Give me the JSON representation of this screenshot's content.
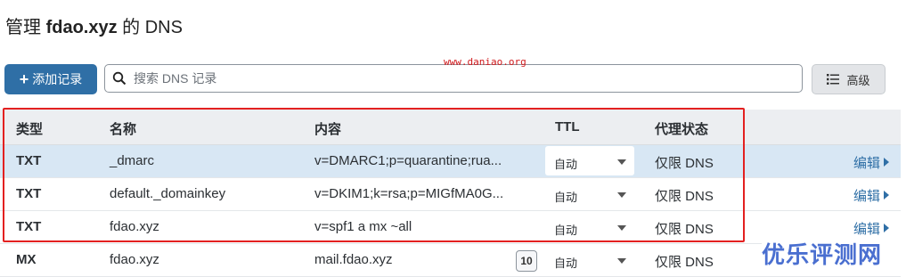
{
  "page": {
    "title_prefix": "管理 ",
    "domain": "fdao.xyz",
    "title_suffix": " 的 DNS"
  },
  "toolbar": {
    "add_label": "添加记录",
    "search_placeholder": "搜索 DNS 记录",
    "advanced_label": "高级"
  },
  "watermark": "www.daniao.org",
  "table": {
    "headers": {
      "type": "类型",
      "name": "名称",
      "content": "内容",
      "ttl": "TTL",
      "proxy": "代理状态"
    },
    "rows": [
      {
        "type": "TXT",
        "name": "_dmarc",
        "content": "v=DMARC1;p=quarantine;rua...",
        "ttl": "自动",
        "proxy": "仅限 DNS",
        "edit": "编辑",
        "priority": ""
      },
      {
        "type": "TXT",
        "name": "default._domainkey",
        "content": "v=DKIM1;k=rsa;p=MIGfMA0G...",
        "ttl": "自动",
        "proxy": "仅限 DNS",
        "edit": "编辑",
        "priority": ""
      },
      {
        "type": "TXT",
        "name": "fdao.xyz",
        "content": "v=spf1 a mx ~all",
        "ttl": "自动",
        "proxy": "仅限 DNS",
        "edit": "编辑",
        "priority": ""
      },
      {
        "type": "MX",
        "name": "fdao.xyz",
        "content": "mail.fdao.xyz",
        "ttl": "自动",
        "proxy": "仅限 DNS",
        "edit": "",
        "priority": "10"
      }
    ]
  },
  "corner_logo": "优乐评测网",
  "colors": {
    "accent": "#2f6fa6",
    "highlight": "#e32020",
    "selected_row": "#d8e7f4"
  }
}
